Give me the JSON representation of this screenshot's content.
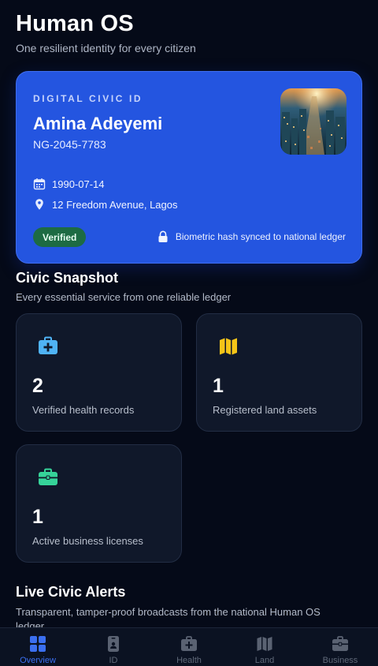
{
  "header": {
    "title": "Human OS",
    "subtitle": "One resilient identity for every citizen"
  },
  "id_card": {
    "eyebrow": "DIGITAL CIVIC ID",
    "name": "Amina Adeyemi",
    "id_number": "NG-2045-7783",
    "dob": "1990-07-14",
    "address": "12 Freedom Avenue, Lagos",
    "badge": "Verified",
    "sync_note": "Biometric hash synced to national ledger"
  },
  "snapshot": {
    "title": "Civic Snapshot",
    "subtitle": "Every essential service from one reliable ledger",
    "cards": [
      {
        "value": "2",
        "label": "Verified health records",
        "icon": "medical-kit-icon",
        "color": "#4fb3f5"
      },
      {
        "value": "1",
        "label": "Registered land assets",
        "icon": "map-icon",
        "color": "#f5c518"
      },
      {
        "value": "1",
        "label": "Active business licenses",
        "icon": "briefcase-icon",
        "color": "#36d399"
      }
    ]
  },
  "alerts": {
    "title": "Live Civic Alerts",
    "subtitle": "Transparent, tamper-proof broadcasts from the national Human OS ledger"
  },
  "nav": {
    "items": [
      {
        "label": "Overview",
        "icon": "grid-icon",
        "active": true
      },
      {
        "label": "ID",
        "icon": "id-badge-icon",
        "active": false
      },
      {
        "label": "Health",
        "icon": "medical-kit-icon",
        "active": false
      },
      {
        "label": "Land",
        "icon": "map-icon",
        "active": false
      },
      {
        "label": "Business",
        "icon": "briefcase-icon",
        "active": false
      }
    ]
  },
  "colors": {
    "background": "#050a18",
    "card_blue": "#2455e0",
    "accent": "#3b6ff0",
    "verified_green": "#1d6b43"
  }
}
